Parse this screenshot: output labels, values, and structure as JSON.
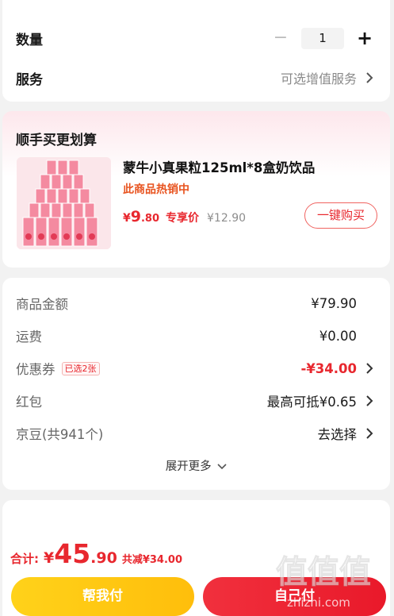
{
  "quantity": {
    "label": "数量",
    "value": "1",
    "minus": "−",
    "plus": "+"
  },
  "service": {
    "label": "服务",
    "value": "可选增值服务"
  },
  "bundle": {
    "title": "顺手买更划算",
    "product_name": "蒙牛小真果粒125ml*8盒奶饮品",
    "hot_tag": "此商品热销中",
    "price_symbol": "¥",
    "price_int": "9",
    "price_dec": ".80",
    "exclusive": "专享价",
    "original_price": "¥12.90",
    "buy_button": "一键购买"
  },
  "fees": {
    "goods_label": "商品金额",
    "goods_value": "¥79.90",
    "shipping_label": "运费",
    "shipping_value": "¥0.00",
    "coupon_label": "优惠券",
    "coupon_badge": "已选2张",
    "coupon_value": "-¥34.00",
    "redpacket_label": "红包",
    "redpacket_value": "最高可抵¥0.65",
    "jingdou_label": "京豆(共941个)",
    "jingdou_value": "去选择",
    "expand": "展开更多"
  },
  "footer": {
    "total_label": "合计:",
    "total_symbol": "¥",
    "total_int": "45",
    "total_dec": ".90",
    "saved": "共减¥34.00",
    "pay_for_me": "帮我付",
    "self_pay": "自己付"
  },
  "watermark": {
    "text": "值值值",
    "url": "zhizhi.com"
  },
  "colors": {
    "accent_red": "#e8272e",
    "yellow": "#ffc812",
    "orange": "#e8531f"
  }
}
